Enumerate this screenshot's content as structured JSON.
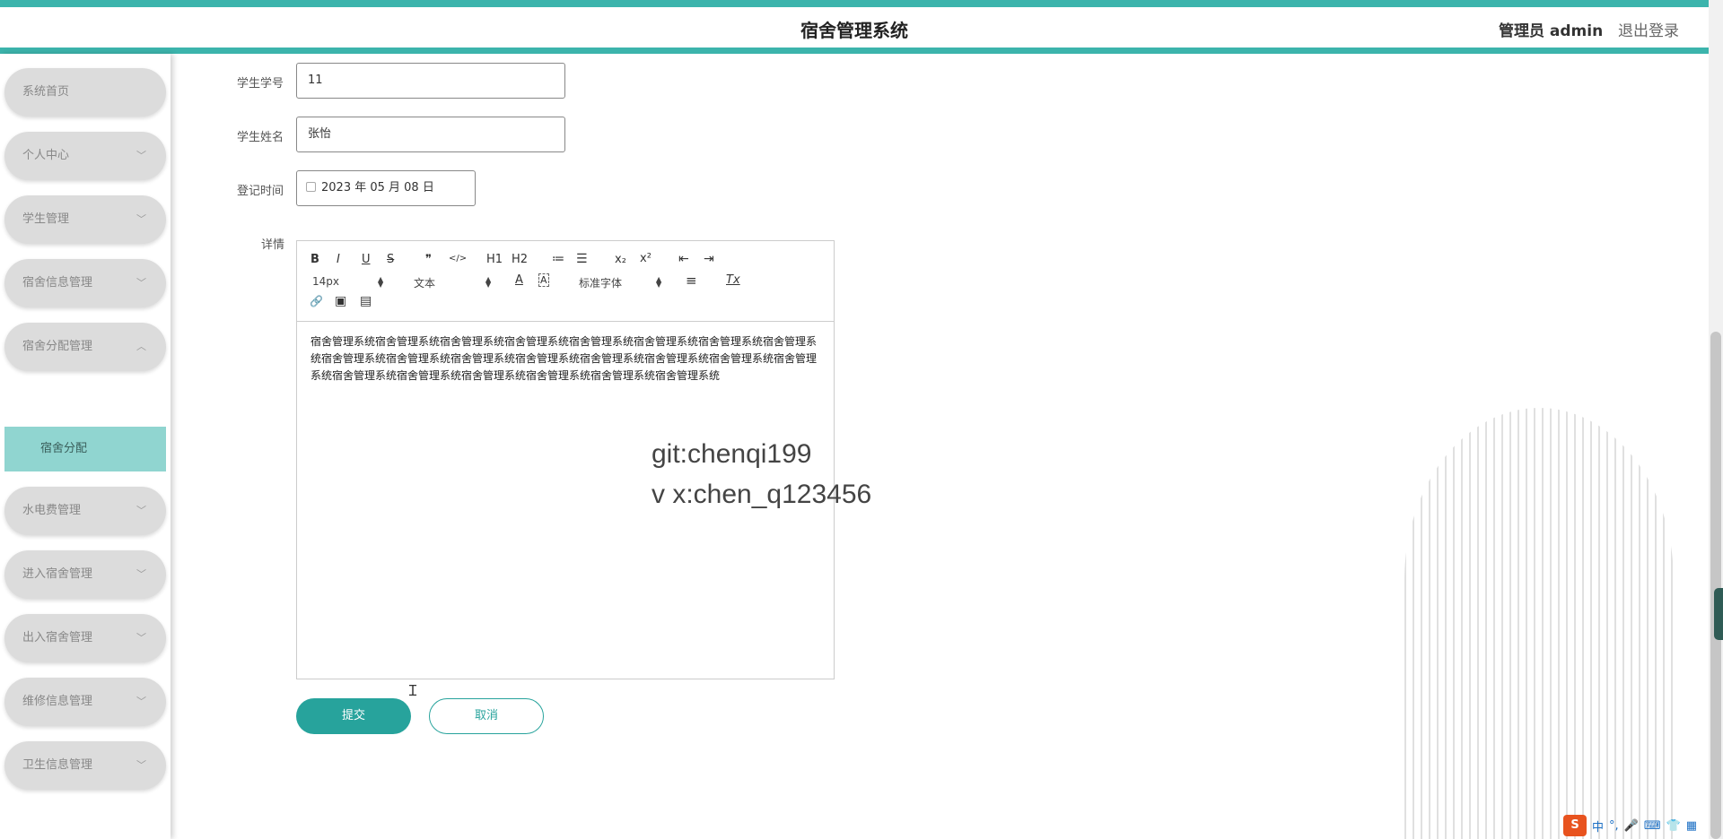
{
  "header": {
    "app_title": "宿舍管理系统",
    "user_label": "管理员 admin",
    "logout_label": "退出登录",
    "accent_color": "#3cb4ac"
  },
  "sidebar": {
    "items": [
      {
        "label": "系统首页",
        "chevron": ""
      },
      {
        "label": "个人中心",
        "chevron": "﹀"
      },
      {
        "label": "学生管理",
        "chevron": "﹀"
      },
      {
        "label": "宿舍信息管理",
        "chevron": "﹀"
      },
      {
        "label": "宿舍分配管理",
        "chevron": "︿"
      },
      {
        "label": "水电费管理",
        "chevron": "﹀"
      },
      {
        "label": "进入宿舍管理",
        "chevron": "﹀"
      },
      {
        "label": "出入宿舍管理",
        "chevron": "﹀"
      },
      {
        "label": "维修信息管理",
        "chevron": "﹀"
      },
      {
        "label": "卫生信息管理",
        "chevron": "﹀"
      }
    ],
    "sub_item": "宿舍分配"
  },
  "form": {
    "student_id_label": "学生学号",
    "student_id_value": "11",
    "student_name_label": "学生姓名",
    "student_name_value": "张怡",
    "date_label": "登记时间",
    "date_value": "2023 年 05 月 08 日",
    "detail_label": "详情"
  },
  "editor": {
    "toolbar": {
      "bold": "B",
      "italic": "I",
      "underline": "U",
      "strike": "S",
      "blockquote": "❞",
      "code": "</>",
      "h1": "H1",
      "h2": "H2",
      "ordered_list": "≔",
      "bullet_list": "☰",
      "subscript": "x₂",
      "superscript": "x²",
      "outdent": "⇤",
      "indent": "⇥",
      "size_select": "14px",
      "header_select": "文本",
      "font_color": "A",
      "bg_color": "A",
      "font_select": "标准字体",
      "align": "≡",
      "clean": "Tx",
      "link": "🔗",
      "image": "▣",
      "video": "▤"
    },
    "content": "宿舍管理系统宿舍管理系统宿舍管理系统宿舍管理系统宿舍管理系统宿舍管理系统宿舍管理系统宿舍管理系统宿舍管理系统宿舍管理系统宿舍管理系统宿舍管理系统宿舍管理系统宿舍管理系统宿舍管理系统宿舍管理系统宿舍管理系统宿舍管理系统宿舍管理系统宿舍管理系统宿舍管理系统宿舍管理系统"
  },
  "watermark": {
    "line1": "git:chenqi199",
    "line2": "v x:chen_q123456"
  },
  "buttons": {
    "submit": "提交",
    "cancel": "取消",
    "primary_color": "#27a39c"
  },
  "ime": {
    "logo": "S",
    "mode": "中",
    "punct": "°,",
    "mic": "🎤",
    "keyboard": "⌨",
    "shirt": "👕",
    "grid": "▦"
  }
}
